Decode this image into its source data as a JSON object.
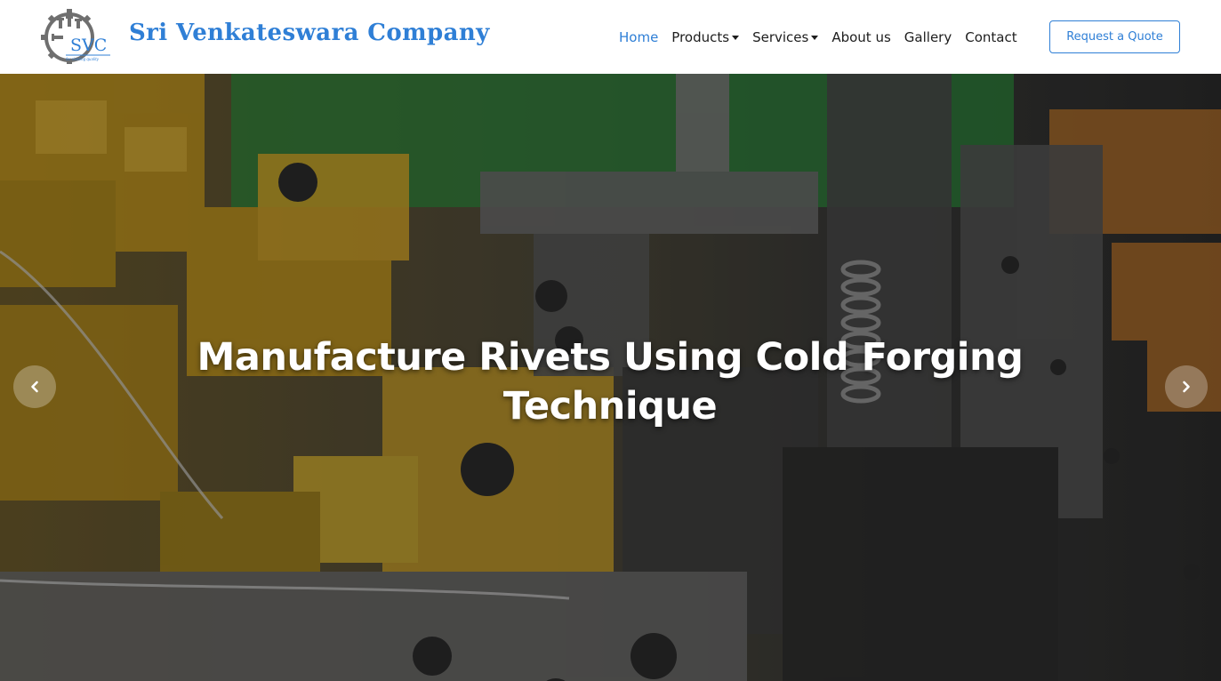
{
  "brand": {
    "logo_text": "SVC",
    "logo_tagline": "for riveting quality",
    "name": "Sri Venkateswara Company"
  },
  "nav": {
    "items": [
      {
        "label": "Home",
        "active": true,
        "dropdown": false
      },
      {
        "label": "Products",
        "active": false,
        "dropdown": true
      },
      {
        "label": "Services",
        "active": false,
        "dropdown": true
      },
      {
        "label": "About us",
        "active": false,
        "dropdown": false
      },
      {
        "label": "Gallery",
        "active": false,
        "dropdown": false
      },
      {
        "label": "Contact",
        "active": false,
        "dropdown": false
      }
    ],
    "cta_label": "Request a Quote"
  },
  "hero": {
    "title": "Manufacture Rivets Using Cold Forging Technique",
    "prev_icon": "chevron-left-icon",
    "next_icon": "chevron-right-icon"
  },
  "colors": {
    "brand_blue": "#2f7fd6",
    "nav_text": "#1d1d1d",
    "machine_yellow": "#d9a21c",
    "machine_green": "#2e8a3c"
  }
}
